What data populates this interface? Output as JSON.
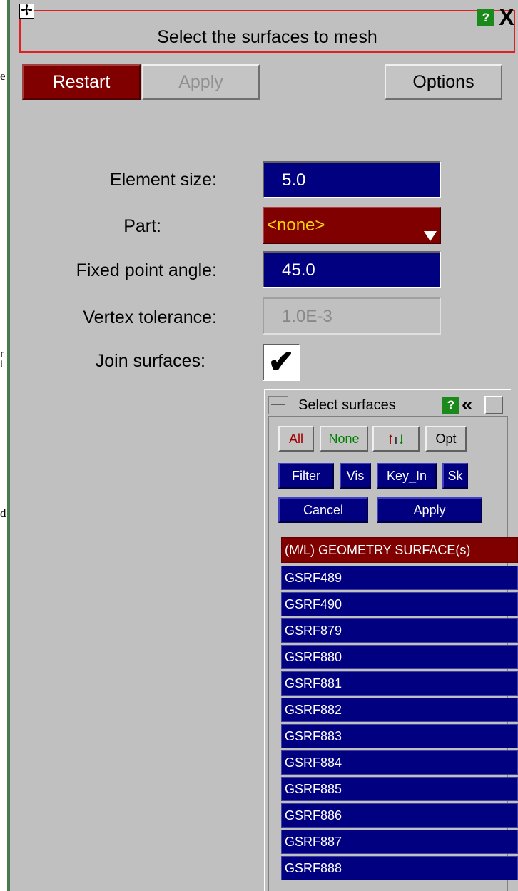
{
  "outside_fragments": [
    "e",
    "r",
    "t",
    "d"
  ],
  "header": {
    "title": "Select the surfaces to mesh",
    "help_label": "?",
    "close_label": "X"
  },
  "toolbar": {
    "restart_label": "Restart",
    "apply_label": "Apply",
    "options_label": "Options"
  },
  "form": {
    "element_size_label": "Element size:",
    "element_size_value": "5.0",
    "part_label": "Part:",
    "part_value": "<none>",
    "fixed_point_angle_label": "Fixed point angle:",
    "fixed_point_angle_value": "45.0",
    "vertex_tolerance_label": "Vertex tolerance:",
    "vertex_tolerance_value": "1.0E-3",
    "join_surfaces_label": "Join surfaces:",
    "join_surfaces_checked": true
  },
  "selector": {
    "title": "Select surfaces",
    "help_label": "?",
    "buttons": {
      "all": "All",
      "none": "None",
      "opt": "Opt",
      "filter": "Filter",
      "vis": "Vis",
      "key_in": "Key_In",
      "sk": "Sk",
      "cancel": "Cancel",
      "apply": "Apply"
    },
    "list_header": "(M/L) GEOMETRY SURFACE(s)",
    "items": [
      "GSRF489",
      "GSRF490",
      "GSRF879",
      "GSRF880",
      "GSRF881",
      "GSRF882",
      "GSRF883",
      "GSRF884",
      "GSRF885",
      "GSRF886",
      "GSRF887",
      "GSRF888"
    ]
  },
  "colors": {
    "panel_bg": "#c0c0c0",
    "field_blue": "#000080",
    "restart_red": "#800000",
    "title_border": "#e02020",
    "help_green": "#1a8a1a"
  }
}
